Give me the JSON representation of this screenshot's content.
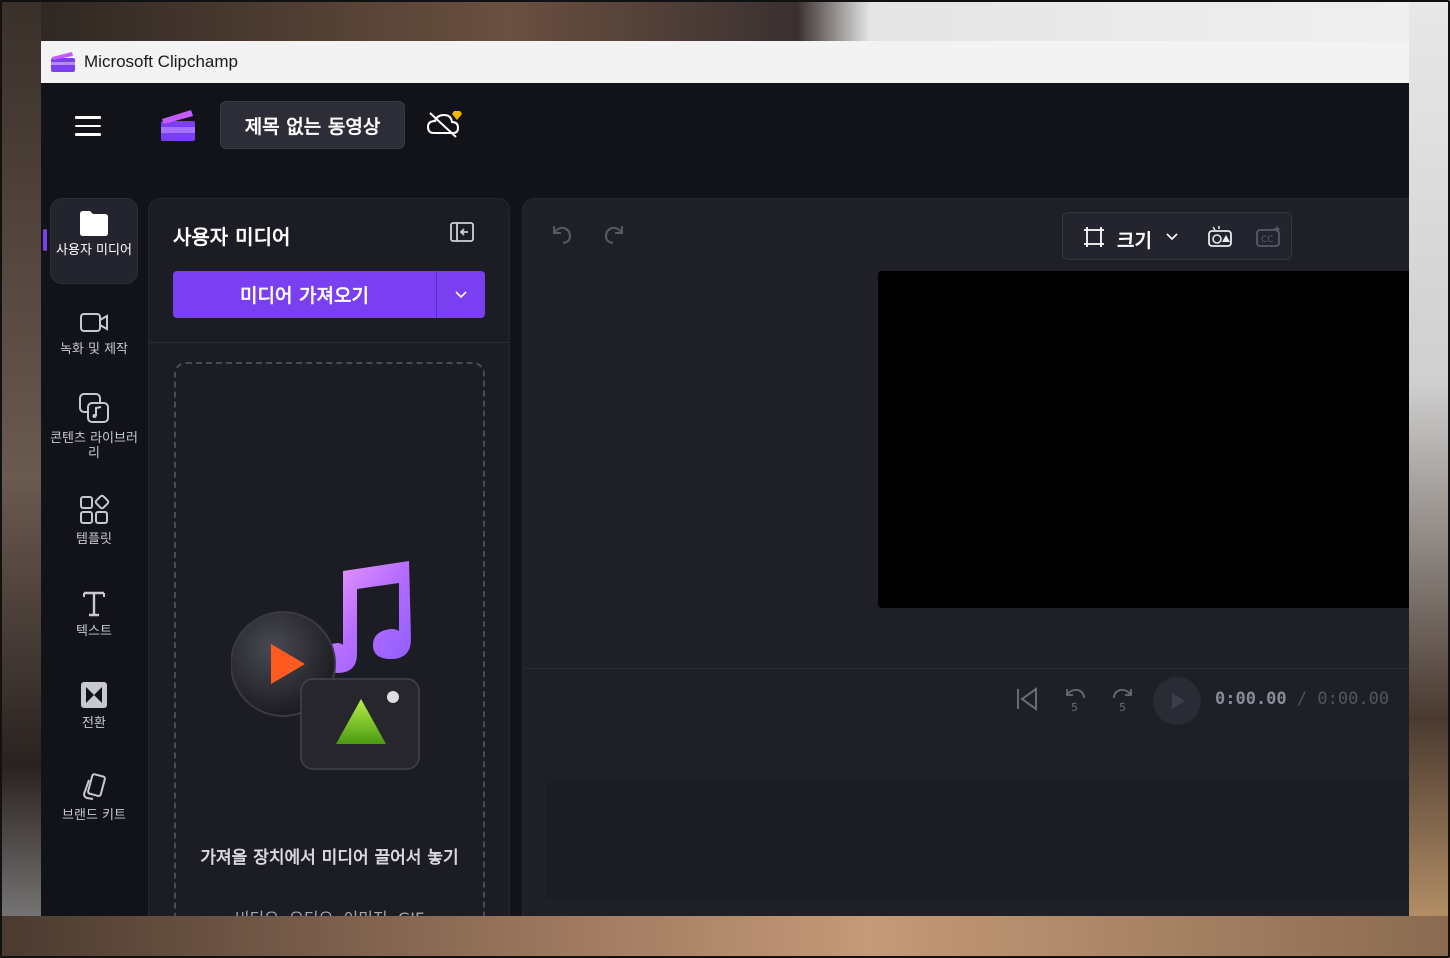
{
  "window": {
    "title": "Microsoft Clipchamp"
  },
  "header": {
    "project_title": "제목 없는 동영상",
    "menu_icon": "hamburger-menu-icon",
    "sync_icon": "cloud-off-premium-icon"
  },
  "nav": {
    "items": [
      {
        "label": "사용자 미디어",
        "icon": "folder-icon",
        "active": true
      },
      {
        "label": "녹화 및 제작",
        "icon": "video-camera-icon"
      },
      {
        "label": "콘텐츠 라이브러리",
        "icon": "library-icon"
      },
      {
        "label": "템플릿",
        "icon": "templates-icon"
      },
      {
        "label": "텍스트",
        "icon": "text-icon"
      },
      {
        "label": "전환",
        "icon": "transitions-icon"
      },
      {
        "label": "브랜드 키트",
        "icon": "brand-kit-icon"
      }
    ]
  },
  "media_panel": {
    "title": "사용자 미디어",
    "import_button": "미디어 가져오기",
    "drop_title": "가져올 장치에서 미디어 끌어서 놓기",
    "drop_subtitle": "비디오, 오디오, 이미지, GIF"
  },
  "preview": {
    "size_label": "크기",
    "current_time": "0:00.00",
    "separator": "/",
    "duration": "0:00.00",
    "skip_back_seconds": "5",
    "skip_forward_seconds": "5"
  },
  "colors": {
    "accent": "#7b3ff2",
    "background": "#121219",
    "panel": "#1c1c25"
  }
}
